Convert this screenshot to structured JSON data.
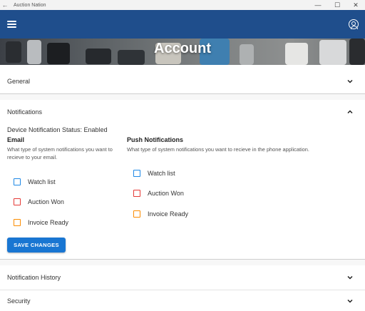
{
  "window": {
    "title": "Auction Nation",
    "back_glyph": "←",
    "minimize_glyph": "—",
    "maximize_glyph": "☐",
    "close_glyph": "✕"
  },
  "appbar": {
    "background": "#1f4e8c",
    "menu_icon": "hamburger-icon",
    "profile_icon": "account-circle-icon"
  },
  "banner": {
    "title": "Account"
  },
  "sections": {
    "general": {
      "label": "General",
      "expanded": false
    },
    "notifications": {
      "label": "Notifications",
      "expanded": true,
      "status": "Device Notification Status: Enabled",
      "email": {
        "heading": "Email",
        "description": "What type of system notifications you want to recieve to your email.",
        "options": [
          {
            "label": "Watch list",
            "color": "#1e88e5",
            "checked": false
          },
          {
            "label": "Auction Won",
            "color": "#e53935",
            "checked": false
          },
          {
            "label": "Invoice Ready",
            "color": "#fb8c00",
            "checked": false
          }
        ]
      },
      "push": {
        "heading": "Push Notifications",
        "description": "What type of system notifications you want to recieve in the phone application.",
        "options": [
          {
            "label": "Watch list",
            "color": "#1e88e5",
            "checked": false
          },
          {
            "label": "Auction Won",
            "color": "#e53935",
            "checked": false
          },
          {
            "label": "Invoice Ready",
            "color": "#fb8c00",
            "checked": false
          }
        ]
      },
      "save_label": "SAVE CHANGES",
      "save_color": "#1976d2"
    },
    "notification_history": {
      "label": "Notification History",
      "expanded": false
    },
    "security": {
      "label": "Security",
      "expanded": false
    }
  }
}
